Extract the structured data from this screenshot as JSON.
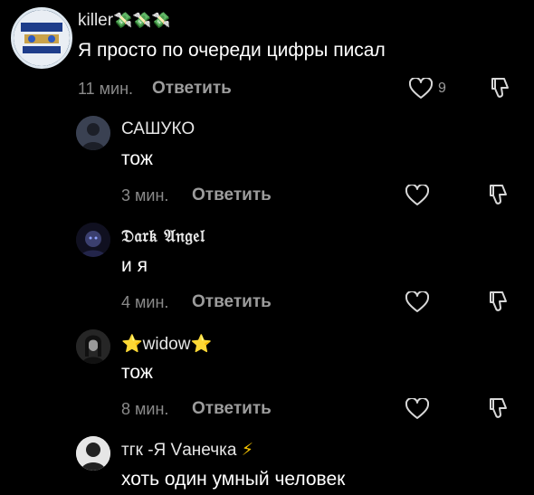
{
  "comments": [
    {
      "author": "killer",
      "author_decor": "💸💸💸",
      "text": "Я просто по очереди цифры писал",
      "time": "11 мин.",
      "reply_label": "Ответить",
      "likes": "9"
    },
    {
      "author": "САШУКО",
      "text": "тож",
      "time": "3 мин.",
      "reply_label": "Ответить"
    },
    {
      "author": "𝔇𝔞𝔯𝔨 𝔄𝔫𝔤𝔢𝔩",
      "text": "и я",
      "time": "4 мин.",
      "reply_label": "Ответить"
    },
    {
      "author_prefix": "⭐",
      "author": "widow",
      "author_suffix": "⭐",
      "text": "тож",
      "time": "8 мин.",
      "reply_label": "Ответить"
    },
    {
      "author": "тгк -Я Vанечка",
      "author_suffix": "⚡",
      "text": "хоть один умный человек"
    }
  ],
  "icons": {
    "like": "heart-icon",
    "dislike": "thumbs-down-icon"
  },
  "colors": {
    "background": "#000000",
    "text": "#ffffff",
    "meta": "#8a8a8a",
    "reply": "#9c9c9c"
  }
}
